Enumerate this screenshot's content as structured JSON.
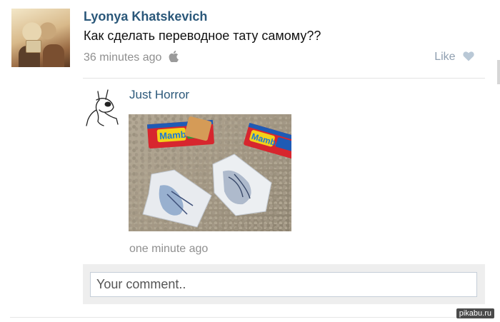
{
  "post": {
    "author": "Lyonya Khatskevich",
    "text": "Как сделать переводное тату самому??",
    "time": "36 minutes ago",
    "platform_icon": "apple-icon",
    "like_label": "Like",
    "like_icon": "heart-icon"
  },
  "reply": {
    "author": "Just Horror",
    "time": "one minute ago",
    "photo": {
      "candy_label": "Mamba"
    }
  },
  "comment": {
    "placeholder": "Your comment.."
  },
  "watermark": "pikabu.ru",
  "colors": {
    "link": "#2b587a",
    "muted": "#8f8f8f",
    "like": "#8f9fb0",
    "comment_bg": "#eeeeee"
  }
}
